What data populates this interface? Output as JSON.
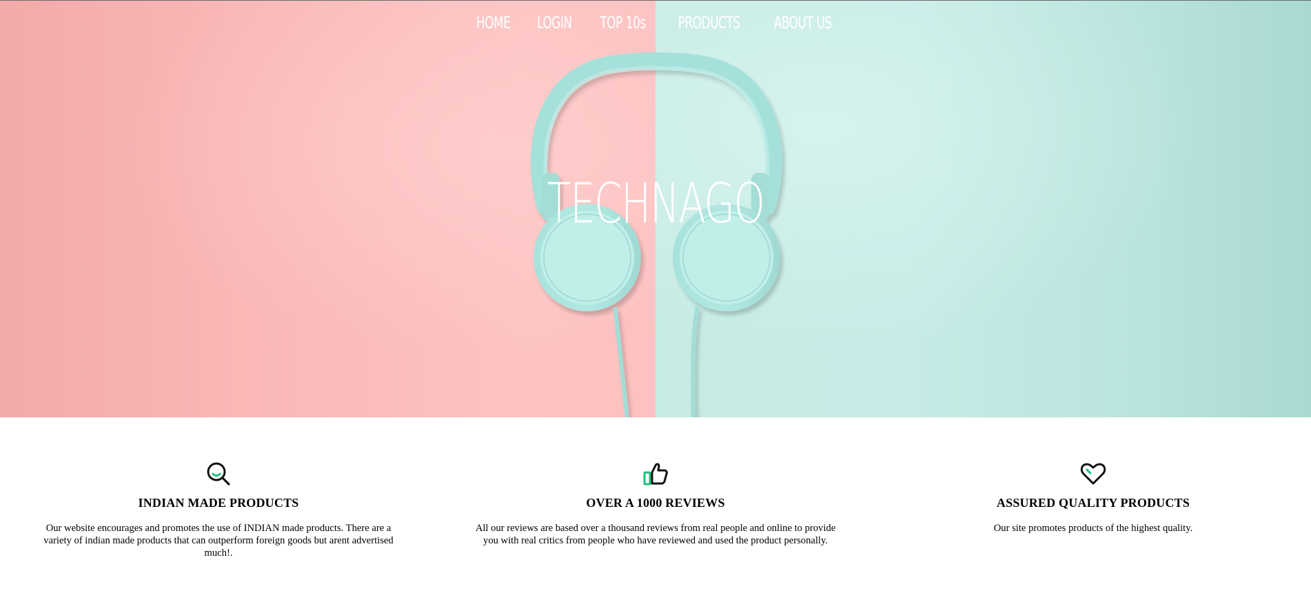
{
  "nav": {
    "items": [
      {
        "label": "HOME"
      },
      {
        "label": "LOGIN"
      },
      {
        "label": "TOP 10s"
      },
      {
        "label": "PRODUCTS"
      },
      {
        "label": "ABOUT US"
      }
    ]
  },
  "hero": {
    "brand": "TECHNAGO",
    "colors": {
      "left_panel": "#fcc1c0",
      "right_panel": "#c6ebe4",
      "headphones": "#a9e4df",
      "text": "#ffffff"
    }
  },
  "features": [
    {
      "icon": "search-icon",
      "title": "INDIAN MADE PRODUCTS",
      "text": "Our website encourages and promotes the use of INDIAN made products. There are a variety of indian made products that can outperform foreign goods but arent advertised much!."
    },
    {
      "icon": "thumbs-up-icon",
      "title": "OVER A 1000 REVIEWS",
      "text": "All our reviews are based over a thousand reviews from real people and online to provide you with real critics from people who have reviewed and used the product personally."
    },
    {
      "icon": "heart-icon",
      "title": "ASSURED QUALITY PRODUCTS",
      "text": "Our site promotes products of the highest quality."
    }
  ],
  "accent_color": "#19c37a"
}
